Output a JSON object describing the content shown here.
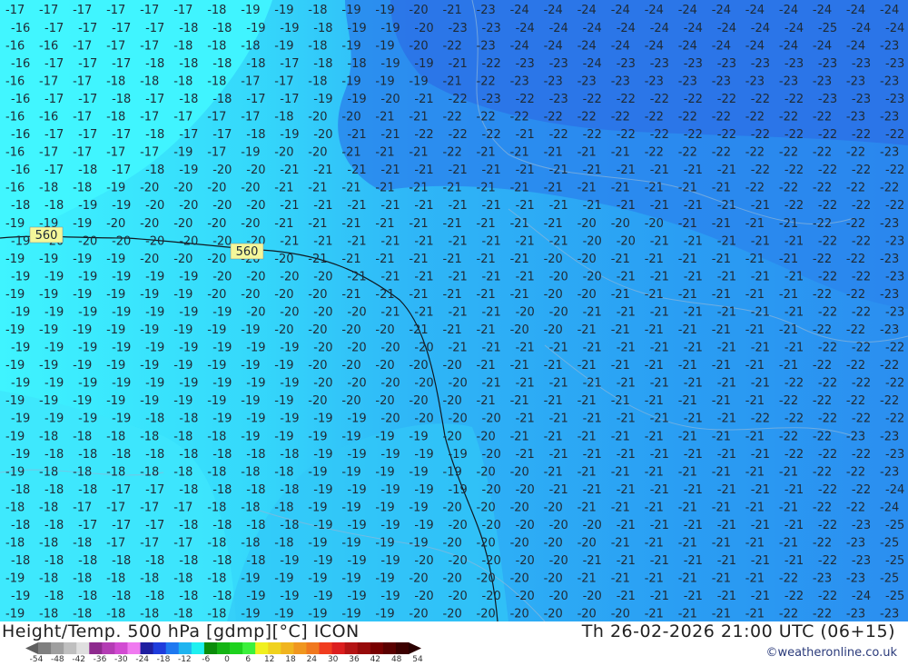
{
  "map": {
    "contour_label": "560",
    "temperature_rows": [
      [
        "17",
        "17",
        "17",
        "17",
        "17",
        "17",
        "18",
        "19",
        "19",
        "18",
        "19",
        "19",
        "20",
        "21",
        "23",
        "24",
        "24",
        "24",
        "24",
        "24",
        "24",
        "24",
        "24",
        "24",
        "24",
        "24",
        "24"
      ],
      [
        "16",
        "17",
        "17",
        "17",
        "17",
        "18",
        "18",
        "19",
        "19",
        "18",
        "19",
        "19",
        "20",
        "23",
        "23",
        "24",
        "24",
        "24",
        "24",
        "24",
        "24",
        "24",
        "24",
        "24",
        "25",
        "24",
        "24"
      ],
      [
        "16",
        "16",
        "17",
        "17",
        "17",
        "18",
        "18",
        "18",
        "19",
        "18",
        "19",
        "19",
        "20",
        "22",
        "23",
        "24",
        "24",
        "24",
        "24",
        "24",
        "24",
        "24",
        "24",
        "24",
        "24",
        "24",
        "23"
      ],
      [
        "16",
        "17",
        "17",
        "17",
        "18",
        "18",
        "18",
        "18",
        "17",
        "18",
        "18",
        "19",
        "19",
        "21",
        "22",
        "23",
        "23",
        "24",
        "23",
        "23",
        "23",
        "23",
        "23",
        "23",
        "23",
        "23",
        "23"
      ],
      [
        "16",
        "17",
        "17",
        "18",
        "18",
        "18",
        "18",
        "17",
        "17",
        "18",
        "19",
        "19",
        "19",
        "21",
        "22",
        "23",
        "23",
        "23",
        "23",
        "23",
        "23",
        "23",
        "23",
        "23",
        "23",
        "23",
        "23"
      ],
      [
        "16",
        "17",
        "17",
        "18",
        "17",
        "18",
        "18",
        "17",
        "17",
        "19",
        "19",
        "20",
        "21",
        "22",
        "23",
        "22",
        "23",
        "22",
        "22",
        "22",
        "22",
        "22",
        "22",
        "22",
        "23",
        "23",
        "23"
      ],
      [
        "16",
        "16",
        "17",
        "18",
        "17",
        "17",
        "17",
        "17",
        "18",
        "20",
        "20",
        "21",
        "21",
        "22",
        "22",
        "22",
        "22",
        "22",
        "22",
        "22",
        "22",
        "22",
        "22",
        "22",
        "22",
        "23",
        "23"
      ],
      [
        "16",
        "17",
        "17",
        "17",
        "18",
        "17",
        "17",
        "18",
        "19",
        "20",
        "21",
        "21",
        "22",
        "22",
        "22",
        "21",
        "22",
        "22",
        "22",
        "22",
        "22",
        "22",
        "22",
        "22",
        "22",
        "22",
        "22"
      ],
      [
        "16",
        "17",
        "17",
        "17",
        "17",
        "19",
        "17",
        "19",
        "20",
        "20",
        "21",
        "21",
        "21",
        "22",
        "21",
        "21",
        "21",
        "21",
        "21",
        "22",
        "22",
        "22",
        "22",
        "22",
        "22",
        "22",
        "23"
      ],
      [
        "16",
        "17",
        "18",
        "17",
        "18",
        "19",
        "20",
        "20",
        "21",
        "21",
        "21",
        "21",
        "21",
        "21",
        "21",
        "21",
        "21",
        "21",
        "21",
        "21",
        "21",
        "21",
        "22",
        "22",
        "22",
        "22",
        "22"
      ],
      [
        "16",
        "18",
        "18",
        "19",
        "20",
        "20",
        "20",
        "20",
        "21",
        "21",
        "21",
        "21",
        "21",
        "21",
        "21",
        "21",
        "21",
        "21",
        "21",
        "21",
        "21",
        "21",
        "22",
        "22",
        "22",
        "22",
        "22"
      ],
      [
        "18",
        "18",
        "19",
        "19",
        "20",
        "20",
        "20",
        "20",
        "21",
        "21",
        "21",
        "21",
        "21",
        "21",
        "21",
        "21",
        "21",
        "21",
        "21",
        "21",
        "21",
        "21",
        "21",
        "22",
        "22",
        "22",
        "22"
      ],
      [
        "19",
        "19",
        "19",
        "20",
        "20",
        "20",
        "20",
        "20",
        "21",
        "21",
        "21",
        "21",
        "21",
        "21",
        "21",
        "21",
        "21",
        "20",
        "20",
        "20",
        "21",
        "21",
        "21",
        "21",
        "22",
        "22",
        "23"
      ],
      [
        "19",
        "20",
        "20",
        "20",
        "20",
        "20",
        "20",
        "20",
        "21",
        "21",
        "21",
        "21",
        "21",
        "21",
        "21",
        "21",
        "21",
        "20",
        "20",
        "21",
        "21",
        "21",
        "21",
        "21",
        "22",
        "22",
        "23"
      ],
      [
        "19",
        "19",
        "19",
        "19",
        "20",
        "20",
        "20",
        "20",
        "20",
        "21",
        "21",
        "21",
        "21",
        "21",
        "21",
        "21",
        "20",
        "20",
        "21",
        "21",
        "21",
        "21",
        "21",
        "21",
        "22",
        "22",
        "23"
      ],
      [
        "19",
        "19",
        "19",
        "19",
        "19",
        "19",
        "20",
        "20",
        "20",
        "20",
        "21",
        "21",
        "21",
        "21",
        "21",
        "21",
        "20",
        "20",
        "21",
        "21",
        "21",
        "21",
        "21",
        "21",
        "22",
        "22",
        "23"
      ],
      [
        "19",
        "19",
        "19",
        "19",
        "19",
        "19",
        "20",
        "20",
        "20",
        "20",
        "21",
        "21",
        "21",
        "21",
        "21",
        "21",
        "20",
        "20",
        "21",
        "21",
        "21",
        "21",
        "21",
        "21",
        "22",
        "22",
        "23"
      ],
      [
        "19",
        "19",
        "19",
        "19",
        "19",
        "19",
        "19",
        "20",
        "20",
        "20",
        "20",
        "21",
        "21",
        "21",
        "21",
        "20",
        "20",
        "21",
        "21",
        "21",
        "21",
        "21",
        "21",
        "21",
        "22",
        "22",
        "23"
      ],
      [
        "19",
        "19",
        "19",
        "19",
        "19",
        "19",
        "19",
        "19",
        "20",
        "20",
        "20",
        "20",
        "21",
        "21",
        "21",
        "20",
        "20",
        "21",
        "21",
        "21",
        "21",
        "21",
        "21",
        "21",
        "22",
        "22",
        "23"
      ],
      [
        "19",
        "19",
        "19",
        "19",
        "19",
        "19",
        "19",
        "19",
        "19",
        "20",
        "20",
        "20",
        "20",
        "21",
        "21",
        "21",
        "21",
        "21",
        "21",
        "21",
        "21",
        "21",
        "21",
        "21",
        "22",
        "22",
        "22"
      ],
      [
        "19",
        "19",
        "19",
        "19",
        "19",
        "19",
        "19",
        "19",
        "19",
        "20",
        "20",
        "20",
        "20",
        "20",
        "21",
        "21",
        "21",
        "21",
        "21",
        "21",
        "21",
        "21",
        "21",
        "21",
        "22",
        "22",
        "22"
      ],
      [
        "19",
        "19",
        "19",
        "19",
        "19",
        "19",
        "19",
        "19",
        "19",
        "20",
        "20",
        "20",
        "20",
        "20",
        "21",
        "21",
        "21",
        "21",
        "21",
        "21",
        "21",
        "21",
        "21",
        "22",
        "22",
        "22",
        "22"
      ],
      [
        "19",
        "19",
        "19",
        "19",
        "19",
        "19",
        "19",
        "19",
        "19",
        "20",
        "20",
        "20",
        "20",
        "20",
        "21",
        "21",
        "21",
        "21",
        "21",
        "21",
        "21",
        "21",
        "21",
        "22",
        "22",
        "22",
        "22"
      ],
      [
        "19",
        "19",
        "19",
        "19",
        "18",
        "18",
        "19",
        "19",
        "19",
        "19",
        "19",
        "20",
        "20",
        "20",
        "20",
        "21",
        "21",
        "21",
        "21",
        "21",
        "21",
        "21",
        "22",
        "22",
        "22",
        "22",
        "22"
      ],
      [
        "19",
        "18",
        "18",
        "18",
        "18",
        "18",
        "18",
        "19",
        "19",
        "19",
        "19",
        "19",
        "19",
        "20",
        "20",
        "21",
        "21",
        "21",
        "21",
        "21",
        "21",
        "21",
        "21",
        "22",
        "22",
        "23",
        "23"
      ],
      [
        "19",
        "18",
        "18",
        "18",
        "18",
        "18",
        "18",
        "18",
        "18",
        "19",
        "19",
        "19",
        "19",
        "19",
        "20",
        "21",
        "21",
        "21",
        "21",
        "21",
        "21",
        "21",
        "21",
        "22",
        "22",
        "22",
        "23"
      ],
      [
        "19",
        "18",
        "18",
        "18",
        "18",
        "18",
        "18",
        "18",
        "18",
        "19",
        "19",
        "19",
        "19",
        "19",
        "20",
        "20",
        "21",
        "21",
        "21",
        "21",
        "21",
        "21",
        "21",
        "21",
        "22",
        "22",
        "23"
      ],
      [
        "18",
        "18",
        "18",
        "17",
        "17",
        "18",
        "18",
        "18",
        "18",
        "19",
        "19",
        "19",
        "19",
        "19",
        "20",
        "20",
        "21",
        "21",
        "21",
        "21",
        "21",
        "21",
        "21",
        "21",
        "22",
        "22",
        "24"
      ],
      [
        "18",
        "18",
        "17",
        "17",
        "17",
        "17",
        "18",
        "18",
        "18",
        "19",
        "19",
        "19",
        "19",
        "20",
        "20",
        "20",
        "20",
        "21",
        "21",
        "21",
        "21",
        "21",
        "21",
        "21",
        "22",
        "22",
        "24"
      ],
      [
        "18",
        "18",
        "17",
        "17",
        "17",
        "18",
        "18",
        "18",
        "18",
        "19",
        "19",
        "19",
        "19",
        "20",
        "20",
        "20",
        "20",
        "20",
        "21",
        "21",
        "21",
        "21",
        "21",
        "21",
        "22",
        "23",
        "25"
      ],
      [
        "18",
        "18",
        "18",
        "17",
        "17",
        "17",
        "18",
        "18",
        "18",
        "19",
        "19",
        "19",
        "19",
        "20",
        "20",
        "20",
        "20",
        "20",
        "21",
        "21",
        "21",
        "21",
        "21",
        "21",
        "22",
        "23",
        "25"
      ],
      [
        "18",
        "18",
        "18",
        "18",
        "18",
        "18",
        "18",
        "18",
        "19",
        "19",
        "19",
        "19",
        "20",
        "20",
        "20",
        "20",
        "20",
        "21",
        "21",
        "21",
        "21",
        "21",
        "21",
        "21",
        "22",
        "23",
        "25"
      ],
      [
        "19",
        "18",
        "18",
        "18",
        "18",
        "18",
        "18",
        "19",
        "19",
        "19",
        "19",
        "19",
        "20",
        "20",
        "20",
        "20",
        "20",
        "21",
        "21",
        "21",
        "21",
        "21",
        "21",
        "22",
        "23",
        "23",
        "25"
      ],
      [
        "19",
        "18",
        "18",
        "18",
        "18",
        "18",
        "18",
        "19",
        "19",
        "19",
        "19",
        "19",
        "20",
        "20",
        "20",
        "20",
        "20",
        "20",
        "21",
        "21",
        "21",
        "21",
        "21",
        "22",
        "22",
        "24",
        "25"
      ],
      [
        "19",
        "18",
        "18",
        "18",
        "18",
        "18",
        "18",
        "19",
        "19",
        "19",
        "19",
        "19",
        "20",
        "20",
        "20",
        "20",
        "20",
        "20",
        "20",
        "21",
        "21",
        "21",
        "21",
        "22",
        "22",
        "23",
        "23"
      ]
    ],
    "colors": {
      "warm_blue": "#36a7f4",
      "cool_cyan": "#3ff0ff",
      "mid_blue": "#2fc2f6",
      "deep_blue": "#2b86ee"
    }
  },
  "footer": {
    "title": "Height/Temp. 500 hPa [gdmp][°C] ICON",
    "datetime": "Th 26-02-2026 21:00 UTC (06+15)",
    "credit": "©weatheronline.co.uk",
    "legend_ticks": [
      "-54",
      "-48",
      "-42",
      "-36",
      "-30",
      "-24",
      "-18",
      "-12",
      "-6",
      "0",
      "6",
      "12",
      "18",
      "24",
      "30",
      "36",
      "42",
      "48",
      "54"
    ],
    "legend_colors": [
      "#7f7f7f",
      "#9f9f9f",
      "#bfbfbf",
      "#dfdfdf",
      "#8e2a8e",
      "#b43cb4",
      "#d24bd2",
      "#f07af0",
      "#1e1ea0",
      "#1e3cdc",
      "#1e78f0",
      "#1eb4f0",
      "#1ef0f0",
      "#0a8c0a",
      "#14b414",
      "#1ed21e",
      "#3cf03c",
      "#f0f01e",
      "#f0d21e",
      "#f0b41e",
      "#f0961e",
      "#f0781e",
      "#f03c1e",
      "#dc1e1e",
      "#b41414",
      "#960a0a",
      "#780000",
      "#5a0000",
      "#3c0000"
    ]
  }
}
